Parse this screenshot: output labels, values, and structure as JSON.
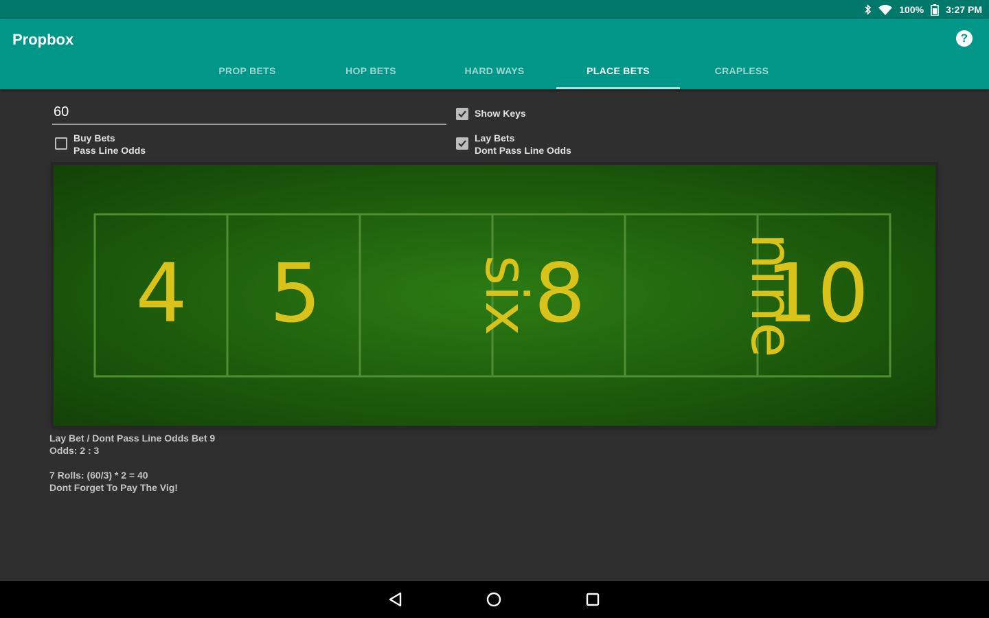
{
  "status_bar": {
    "battery": "100%",
    "time": "3:27 PM",
    "icons": [
      "bluetooth-icon",
      "wifi-icon",
      "battery-icon"
    ]
  },
  "app": {
    "title": "Propbox",
    "help_icon": "help-icon",
    "help_glyph": "?"
  },
  "tabs": [
    {
      "label": "PROP BETS",
      "active": false
    },
    {
      "label": "HOP BETS",
      "active": false
    },
    {
      "label": "HARD WAYS",
      "active": false
    },
    {
      "label": "PLACE BETS",
      "active": true
    },
    {
      "label": "CRAPLESS",
      "active": false
    }
  ],
  "form": {
    "amount_value": "60",
    "show_keys": {
      "label": "Show Keys",
      "checked": true
    },
    "buy_bets": {
      "line1": "Buy Bets",
      "line2": "Pass Line Odds",
      "checked": false
    },
    "lay_bets": {
      "line1": "Lay Bets",
      "line2": "Dont Pass Line Odds",
      "checked": true
    }
  },
  "table": {
    "felt_color": "#20620d",
    "text_color": "#d9c21a",
    "numbers": [
      "4",
      "5",
      "six",
      "8",
      "nine",
      "10"
    ]
  },
  "result": {
    "line1": "Lay Bet / Dont Pass Line Odds Bet 9",
    "line2": "Odds: 2 : 3",
    "line3": "7 Rolls: (60/3) * 2 = 40",
    "line4": "Dont Forget To Pay The Vig!"
  },
  "nav": {
    "back": "back-icon",
    "home": "home-icon",
    "recents": "recents-icon"
  },
  "colors": {
    "primary": "#009688",
    "primary_dark": "#00796b",
    "background": "#2f2f2f"
  }
}
